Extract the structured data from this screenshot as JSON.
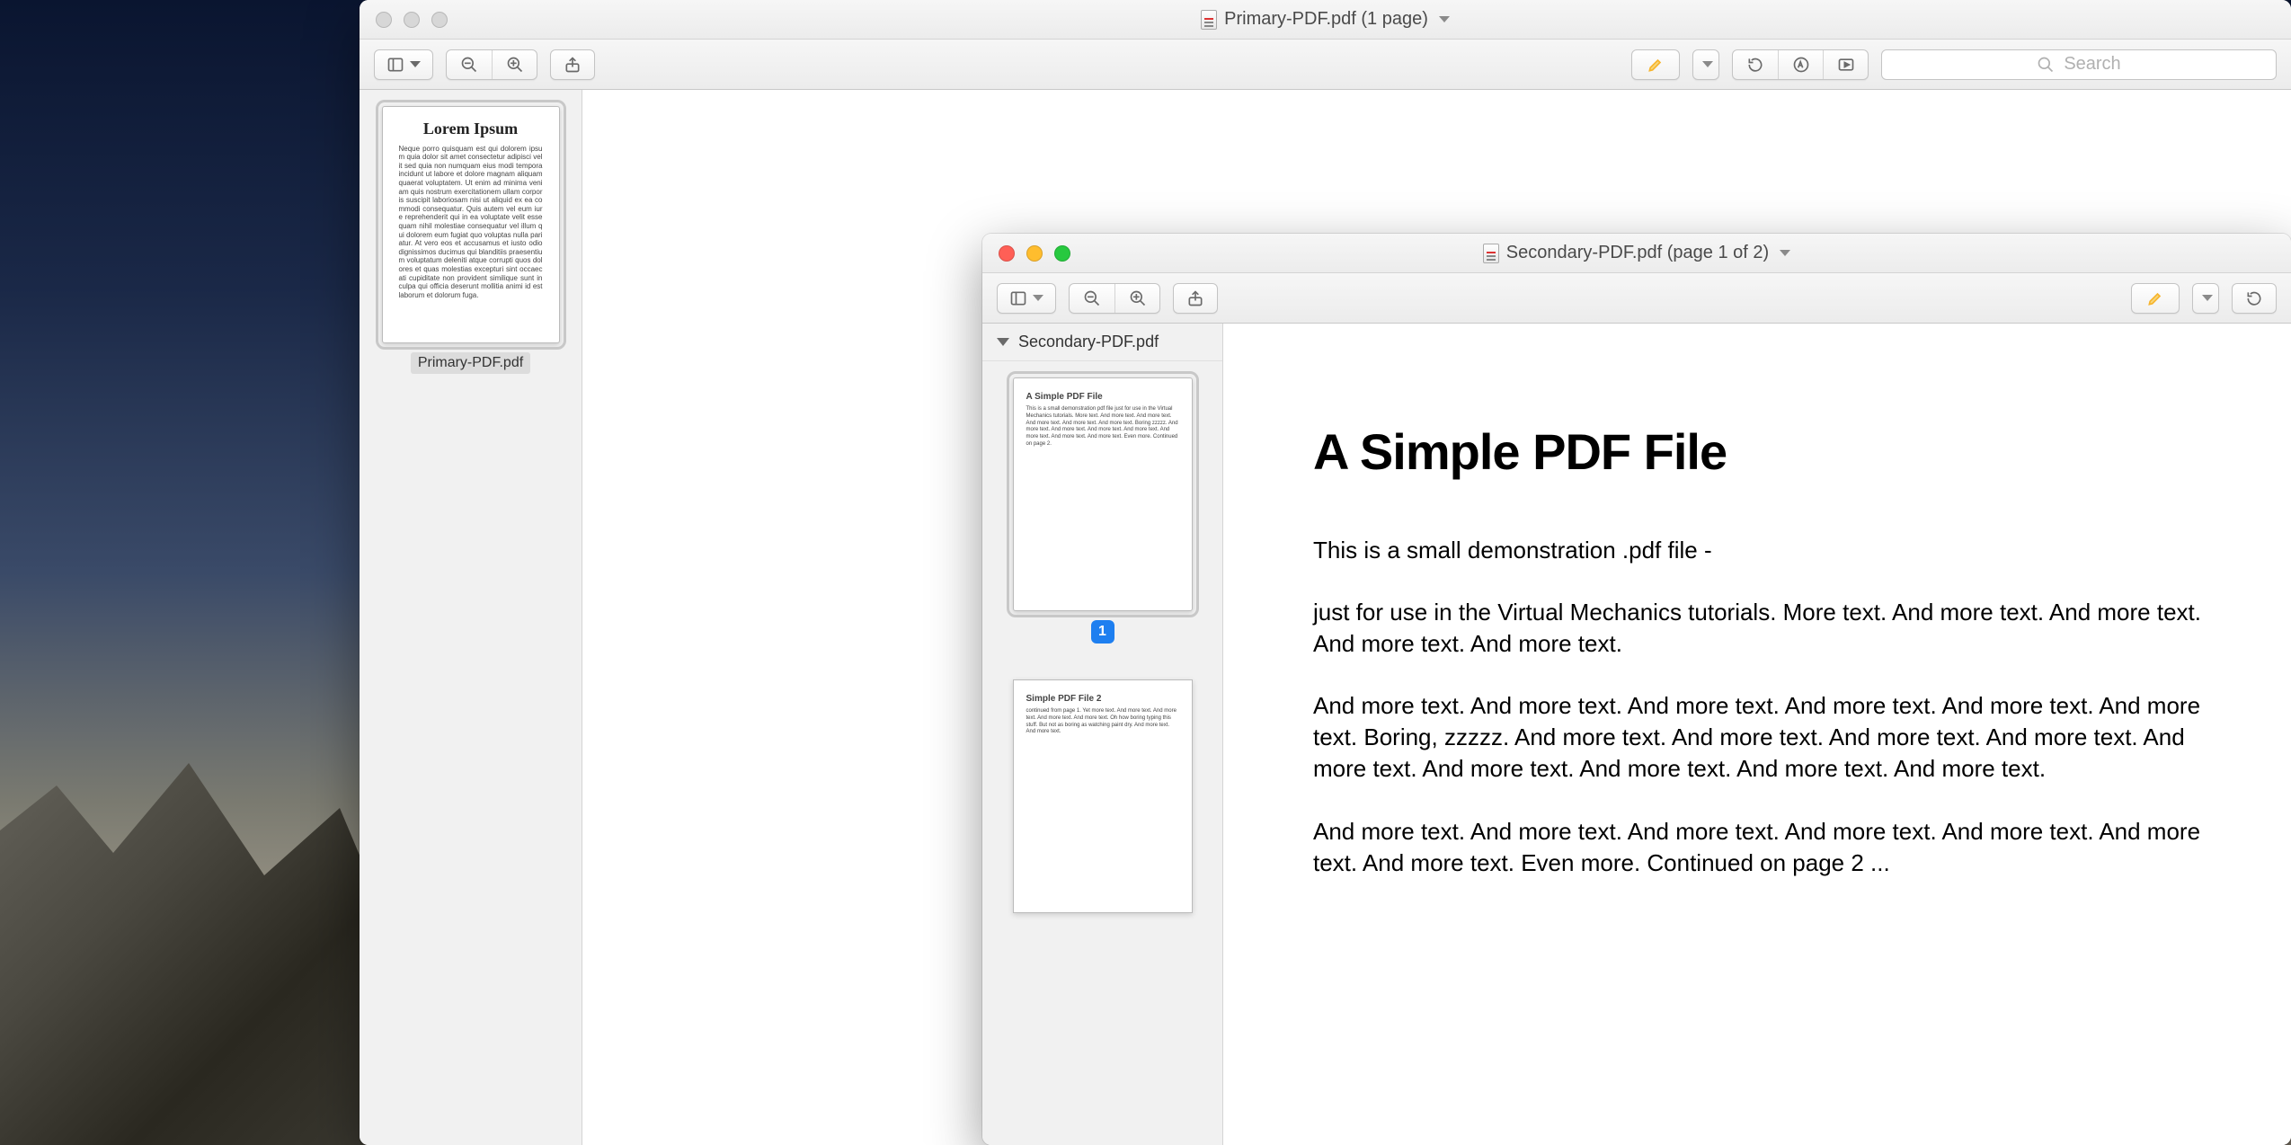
{
  "window1": {
    "title": "Primary-PDF.pdf (1 page)",
    "search_placeholder": "Search",
    "sidebar": {
      "thumbnail_heading": "Lorem Ipsum",
      "thumbnail_label": "Primary-PDF.pdf"
    }
  },
  "window2": {
    "title": "Secondary-PDF.pdf (page 1 of 2)",
    "sidebar": {
      "filename": "Secondary-PDF.pdf",
      "page1_title": "A Simple PDF File",
      "page1_badge": "1",
      "page2_title": "Simple PDF File 2"
    },
    "document": {
      "heading": "A Simple PDF File",
      "p1": "This is a small demonstration .pdf file -",
      "p2": "just for use in the Virtual Mechanics tutorials. More text. And more text. And more text. And more text. And more text.",
      "p3": "And more text. And more text. And more text. And more text. And more text. And more text. Boring, zzzzz. And more text. And more text. And more text. And more text. And more text. And more text. And more text. And more text. And more text.",
      "p4": "And more text. And more text. And more text. And more text. And more text. And more text. And more text. Even more. Continued on page 2 ..."
    }
  }
}
